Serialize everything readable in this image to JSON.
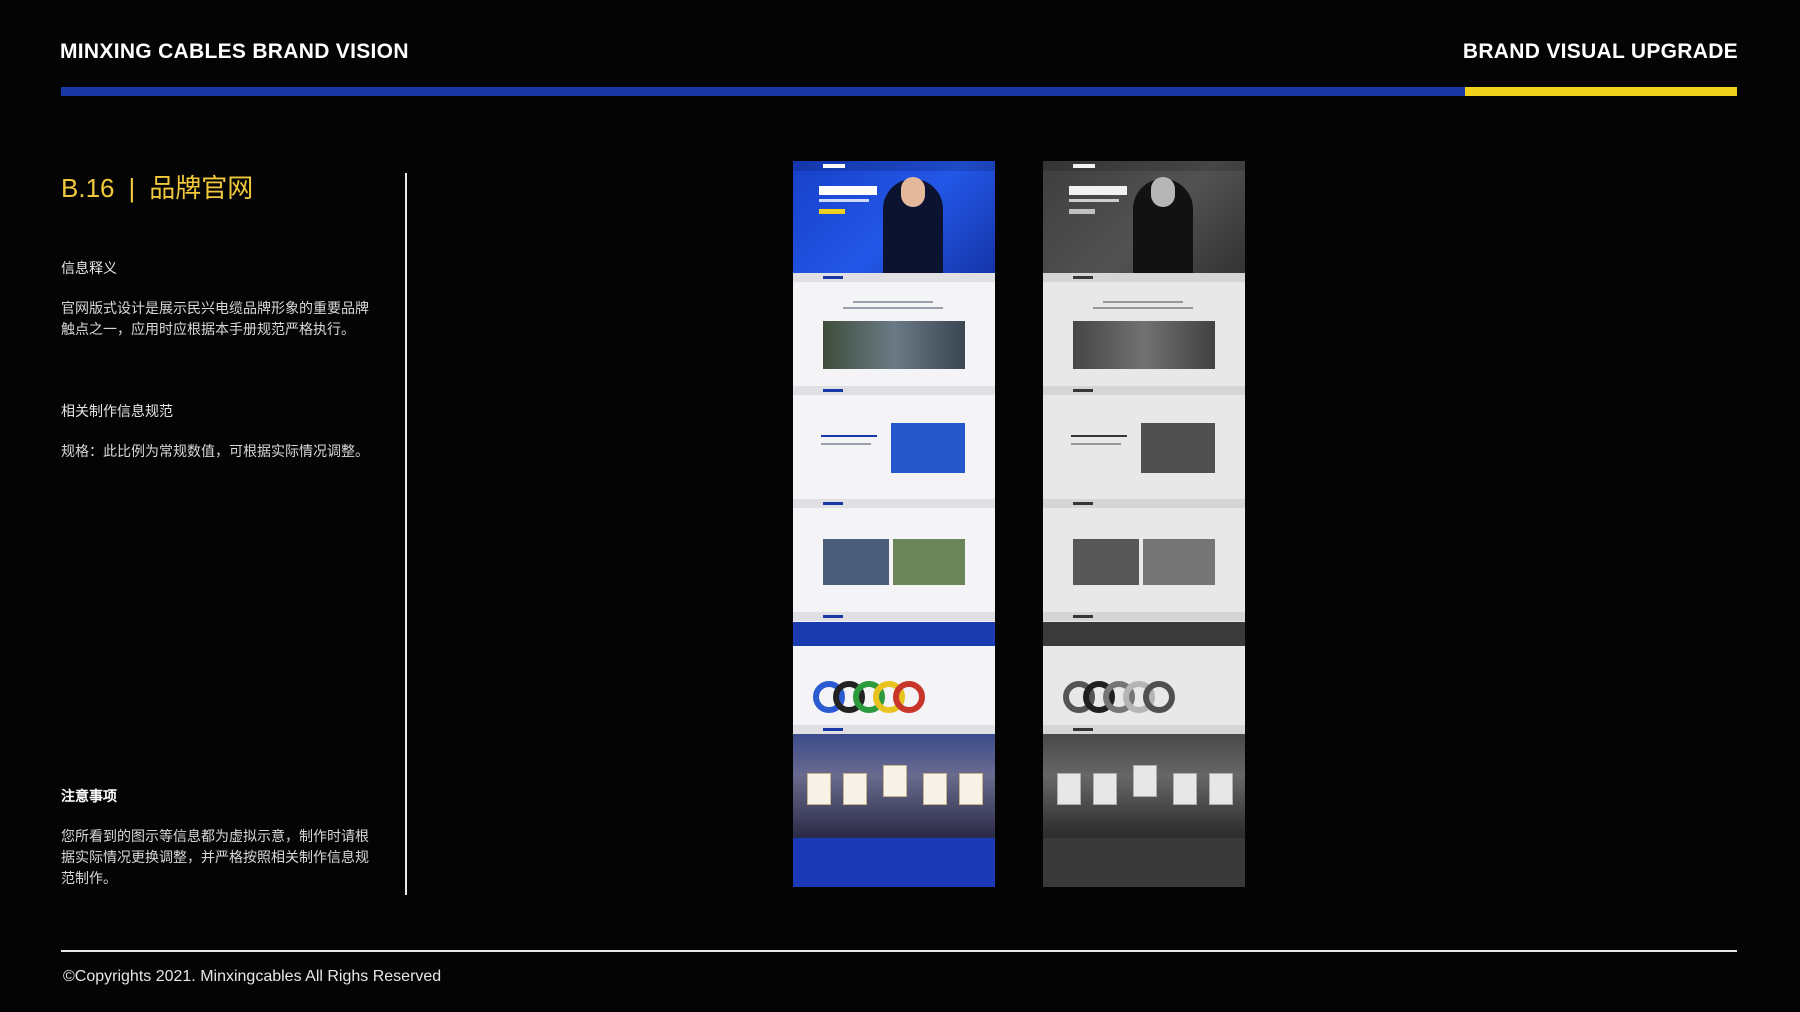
{
  "header": {
    "left_title": "MINXING CABLES BRAND VISION",
    "right_title": "BRAND VISUAL UPGRADE",
    "colors": {
      "rule_blue": "#1a37a6",
      "rule_yellow": "#f0d21e",
      "accent_title": "#f0c93c"
    }
  },
  "section": {
    "code": "B.16",
    "separator": "|",
    "title": "品牌官网"
  },
  "info": {
    "label": "信息释义",
    "body": "官网版式设计是展示民兴电缆品牌形象的重要品牌触点之一，应用时应根据本手册规范严格执行。"
  },
  "spec": {
    "label": "相关制作信息规范",
    "body": "规格：此比例为常规数值，可根据实际情况调整。"
  },
  "notes": {
    "label": "注意事项",
    "body": "您所看到的图示等信息都为虚拟示意，制作时请根据实际情况更换调整，并严格按照相关制作信息规范制作。"
  },
  "mockups": {
    "color_version": {
      "hero_headline": "信民兴,更放心!"
    },
    "gray_version": {
      "hero_headline": "信民兴,更放心!"
    }
  },
  "footer": {
    "copyright": "©Copyrights 2021. Minxingcables All Righs Reserved"
  }
}
